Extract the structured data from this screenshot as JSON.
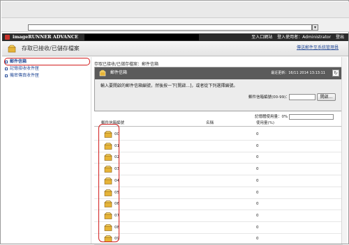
{
  "address_bar": {
    "value": "",
    "dropdown_icon": "chevron-down-icon"
  },
  "app_bar": {
    "app_name": "imageRUNNER ADVANCE",
    "links": [
      "至入口網站",
      "登入使用者：Administrator",
      "登出"
    ]
  },
  "sub_header": {
    "title": "存取已接收/已儲存檔案",
    "link": "傳送郵件至系統管理員"
  },
  "sidebar": {
    "items": [
      {
        "label": "郵件信箱"
      },
      {
        "label": "記憶接收收件匣"
      },
      {
        "label": "機密傳真收件匣"
      }
    ]
  },
  "breadcrumb": "存取已接收/已儲存檔案：郵件信箱",
  "panel": {
    "title": "郵件信箱",
    "last_updated": "最近更新：16/11 2014 13:13:11",
    "instruction": "輸入要開啟的郵件信箱編號，然後按一下[開啟...]，或者從下列選擇編號。",
    "range_label": "郵件信箱編號(00-99)：",
    "range_value": "",
    "open_button": "開啟..."
  },
  "memory_label": "記憶體使用量：0%",
  "table": {
    "columns": [
      "郵件信箱編號",
      "名稱",
      "使用量(%)"
    ],
    "rows": [
      {
        "num": "00",
        "name": "",
        "usage": "0"
      },
      {
        "num": "01",
        "name": "",
        "usage": "0"
      },
      {
        "num": "02",
        "name": "",
        "usage": "0"
      },
      {
        "num": "03",
        "name": "",
        "usage": "0"
      },
      {
        "num": "04",
        "name": "",
        "usage": "0"
      },
      {
        "num": "05",
        "name": "",
        "usage": "0"
      },
      {
        "num": "06",
        "name": "",
        "usage": "0"
      },
      {
        "num": "07",
        "name": "",
        "usage": "0"
      },
      {
        "num": "08",
        "name": "",
        "usage": "0"
      },
      {
        "num": "09",
        "name": "",
        "usage": "0"
      }
    ]
  },
  "colors": {
    "accent_red": "#d21c1c",
    "link_blue": "#2a4f9a",
    "dark_bar": "#2b2b2b",
    "panel_head": "#5b5b5b"
  }
}
